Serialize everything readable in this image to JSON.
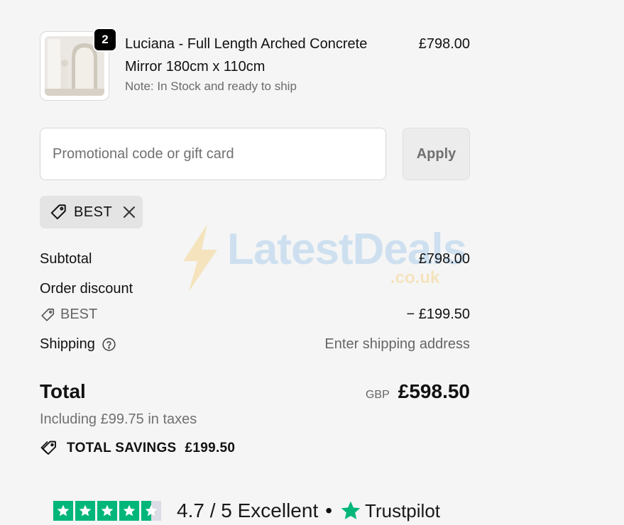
{
  "product": {
    "quantity": "2",
    "name": "Luciana - Full Length Arched Concrete Mirror 180cm x 110cm",
    "note": "Note: In Stock and ready to ship",
    "price": "£798.00"
  },
  "promo": {
    "placeholder": "Promotional code or gift card",
    "apply_label": "Apply"
  },
  "applied_code": {
    "code": "BEST"
  },
  "summary": {
    "subtotal_label": "Subtotal",
    "subtotal_value": "£798.00",
    "order_discount_label": "Order discount",
    "discount_code": "BEST",
    "discount_value": "− £199.50",
    "shipping_label": "Shipping",
    "shipping_value": "Enter shipping address",
    "total_label": "Total",
    "currency": "GBP",
    "total_value": "£598.50",
    "taxes_note": "Including £99.75 in taxes",
    "savings_label": "TOTAL SAVINGS",
    "savings_value": "£199.50"
  },
  "trustpilot": {
    "rating_text": "4.7 / 5 Excellent",
    "separator": "•",
    "brand": "Trustpilot",
    "brand_color": "#00b67a"
  },
  "watermark": {
    "text": "LatestDeals",
    "sub": ".co.uk"
  }
}
